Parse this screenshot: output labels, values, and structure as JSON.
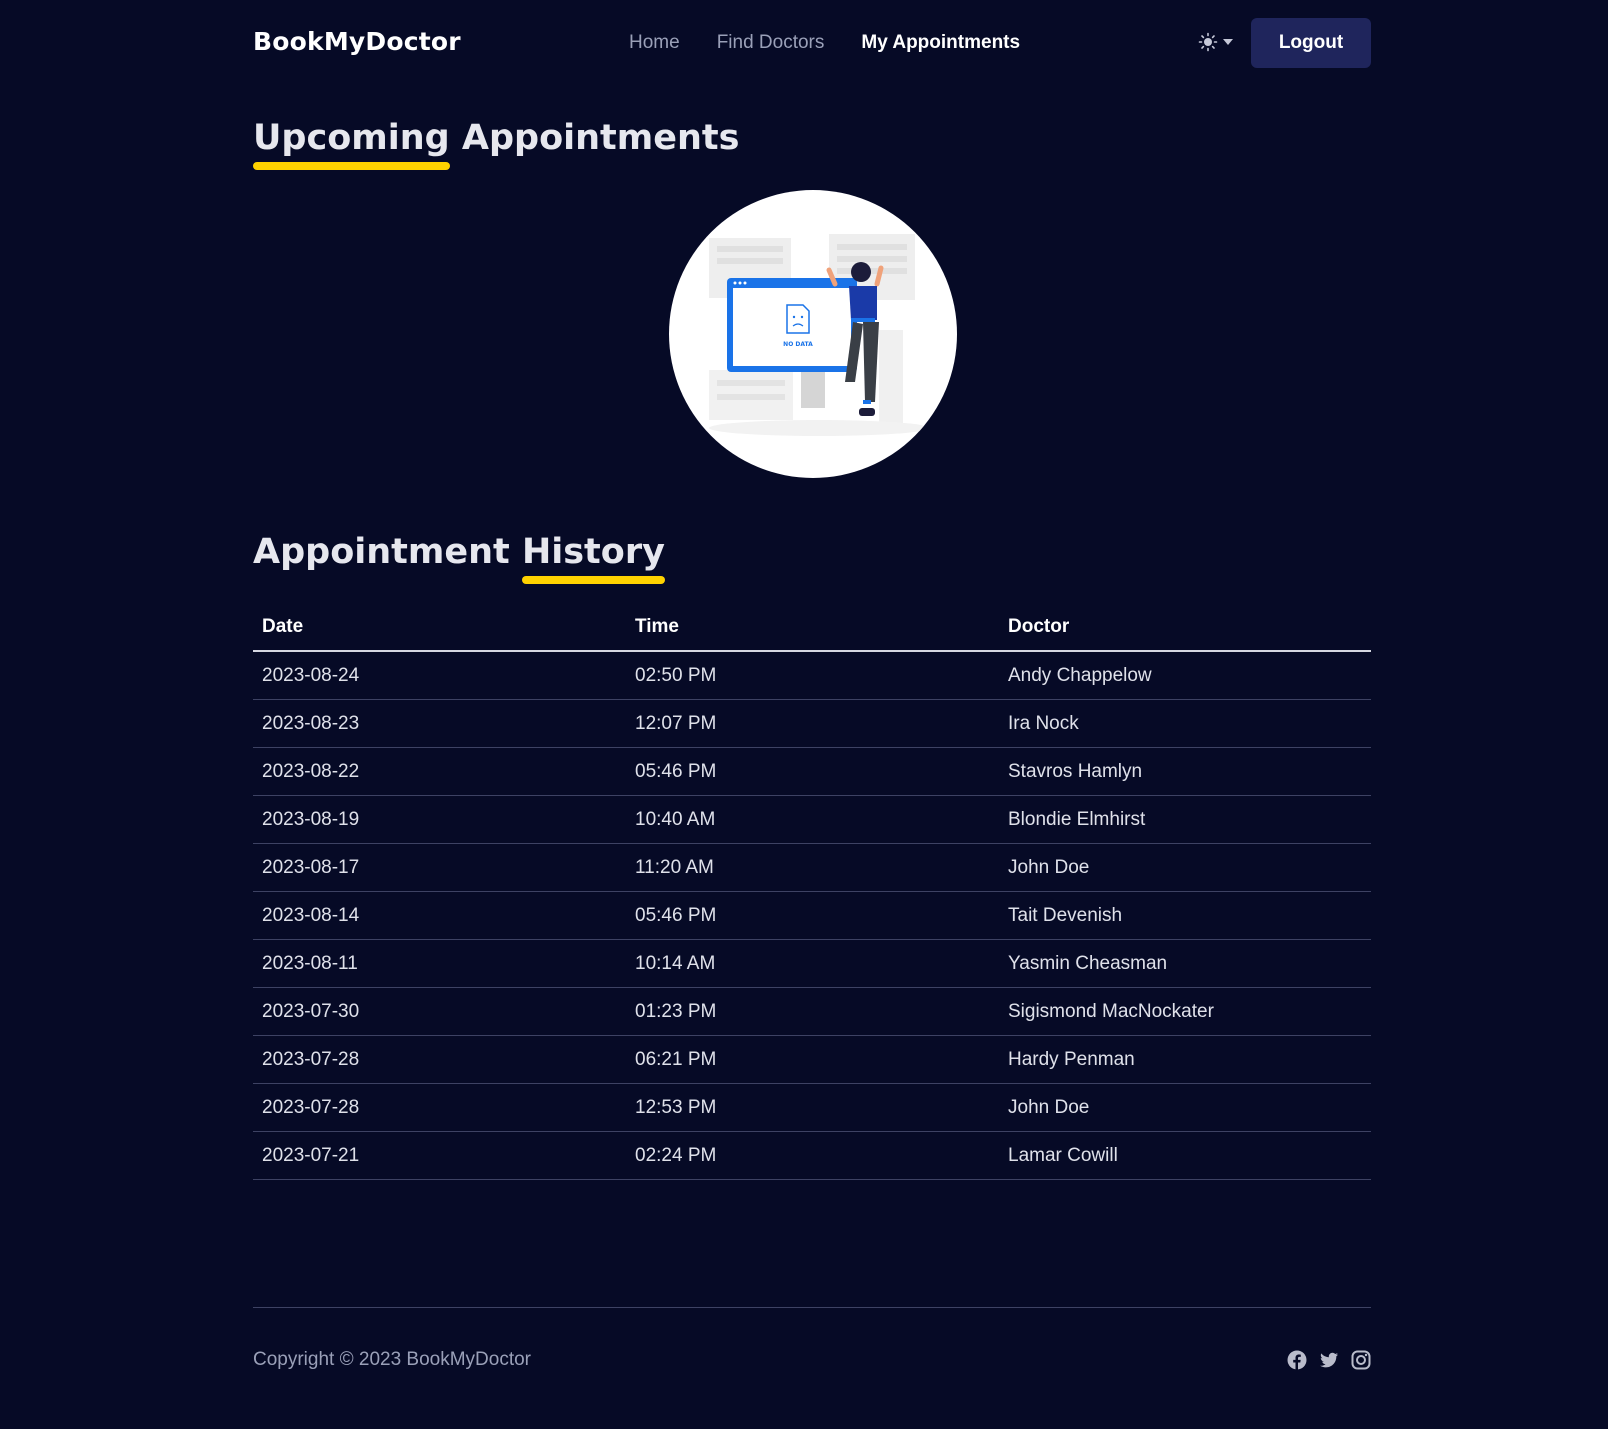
{
  "brand": "BookMyDoctor",
  "nav": {
    "home": "Home",
    "find_doctors": "Find Doctors",
    "my_appointments": "My Appointments",
    "active": "My Appointments"
  },
  "theme_toggle_icon": "sun-icon",
  "logout_label": "Logout",
  "upcoming": {
    "title_part1": "Upcoming",
    "title_part2": "Appointments",
    "illustration_text": "NO DATA"
  },
  "history": {
    "title_part1": "Appointment",
    "title_part2": "History",
    "columns": [
      "Date",
      "Time",
      "Doctor"
    ],
    "rows": [
      {
        "date": "2023-08-24",
        "time": "02:50 PM",
        "doctor": "Andy Chappelow"
      },
      {
        "date": "2023-08-23",
        "time": "12:07 PM",
        "doctor": "Ira Nock"
      },
      {
        "date": "2023-08-22",
        "time": "05:46 PM",
        "doctor": "Stavros Hamlyn"
      },
      {
        "date": "2023-08-19",
        "time": "10:40 AM",
        "doctor": "Blondie Elmhirst"
      },
      {
        "date": "2023-08-17",
        "time": "11:20 AM",
        "doctor": "John Doe"
      },
      {
        "date": "2023-08-14",
        "time": "05:46 PM",
        "doctor": "Tait Devenish"
      },
      {
        "date": "2023-08-11",
        "time": "10:14 AM",
        "doctor": "Yasmin Cheasman"
      },
      {
        "date": "2023-07-30",
        "time": "01:23 PM",
        "doctor": "Sigismond MacNockater"
      },
      {
        "date": "2023-07-28",
        "time": "06:21 PM",
        "doctor": "Hardy Penman"
      },
      {
        "date": "2023-07-28",
        "time": "12:53 PM",
        "doctor": "John Doe"
      },
      {
        "date": "2023-07-21",
        "time": "02:24 PM",
        "doctor": "Lamar Cowill"
      }
    ]
  },
  "footer": {
    "copyright": "Copyright © 2023 BookMyDoctor",
    "socials": [
      "facebook-icon",
      "twitter-icon",
      "instagram-icon"
    ]
  },
  "colors": {
    "background": "#060a26",
    "accent_underline": "#ffd200",
    "button": "#1f255c",
    "illustration_blue": "#1a73e8"
  }
}
